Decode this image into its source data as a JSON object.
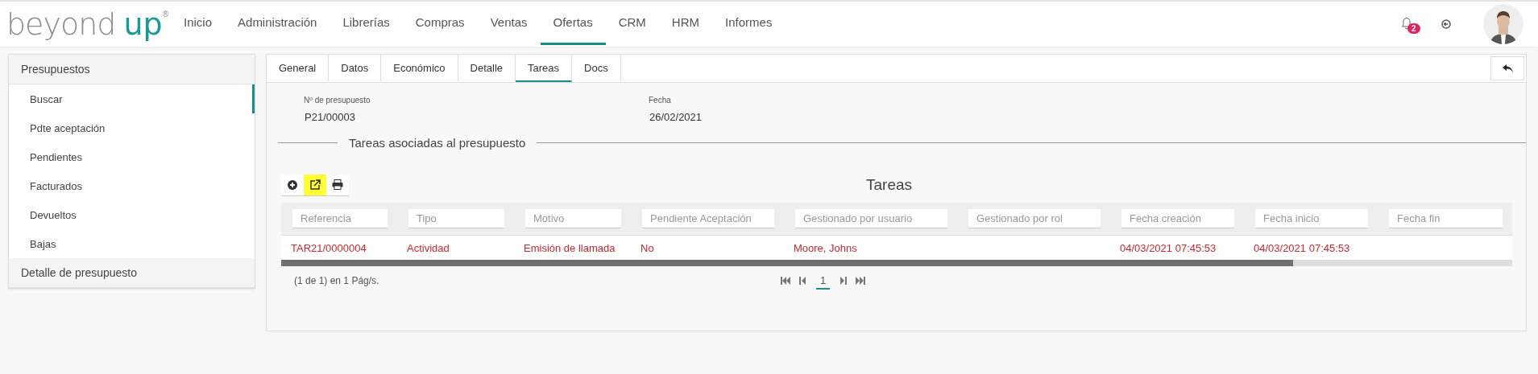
{
  "brand": {
    "word_1": "beyond",
    "word_2": "up",
    "mark": "®"
  },
  "nav": [
    {
      "label": "Inicio",
      "selected": false
    },
    {
      "label": "Administración",
      "selected": false
    },
    {
      "label": "Librerías",
      "selected": false
    },
    {
      "label": "Compras",
      "selected": false
    },
    {
      "label": "Ventas",
      "selected": false
    },
    {
      "label": "Ofertas",
      "selected": true
    },
    {
      "label": "CRM",
      "selected": false
    },
    {
      "label": "HRM",
      "selected": false
    },
    {
      "label": "Informes",
      "selected": false
    }
  ],
  "notifications": {
    "count": "2"
  },
  "sidebar": {
    "sections": [
      {
        "title": "Presupuestos",
        "items": [
          {
            "label": "Buscar",
            "selected": true
          },
          {
            "label": "Pdte aceptación",
            "selected": false
          },
          {
            "label": "Pendientes",
            "selected": false
          },
          {
            "label": "Facturados",
            "selected": false
          },
          {
            "label": "Devueltos",
            "selected": false
          },
          {
            "label": "Bajas",
            "selected": false
          }
        ]
      },
      {
        "title": "Detalle de presupuesto"
      }
    ]
  },
  "tabs": [
    {
      "label": "General",
      "selected": false
    },
    {
      "label": "Datos",
      "selected": false
    },
    {
      "label": "Económico",
      "selected": false
    },
    {
      "label": "Detalle",
      "selected": false
    },
    {
      "label": "Tareas",
      "selected": true
    },
    {
      "label": "Docs",
      "selected": false
    }
  ],
  "fields": [
    {
      "label": "Nº de presupuesto",
      "value": "P21/00003"
    },
    {
      "label": "Fecha",
      "value": "26/02/2021"
    }
  ],
  "section_title": "Tareas asociadas al presupuesto",
  "toolbar": [
    {
      "kind": "add",
      "highlighted": false
    },
    {
      "kind": "export",
      "highlighted": true
    },
    {
      "kind": "print",
      "highlighted": false
    }
  ],
  "table": {
    "title": "Tareas",
    "columns": [
      {
        "placeholder": "Referencia"
      },
      {
        "placeholder": "Tipo"
      },
      {
        "placeholder": "Motivo"
      },
      {
        "placeholder": "Pendiente Aceptación"
      },
      {
        "placeholder": "Gestionado por usuario"
      },
      {
        "placeholder": "Gestionado por rol"
      },
      {
        "placeholder": "Fecha creación"
      },
      {
        "placeholder": "Fecha inicio"
      },
      {
        "placeholder": "Fecha fin"
      }
    ],
    "rows": [
      {
        "cells": [
          "TAR21/0000004",
          "Actividad",
          "Emisión de llamada",
          "No",
          "Moore, Johns",
          null,
          "04/03/2021 07:45:53",
          "04/03/2021 07:45:53",
          null
        ]
      }
    ]
  },
  "pagination": {
    "summary": "(1 de 1) en 1 Pág/s.",
    "pages": [
      {
        "label": "1",
        "selected": true
      }
    ]
  }
}
